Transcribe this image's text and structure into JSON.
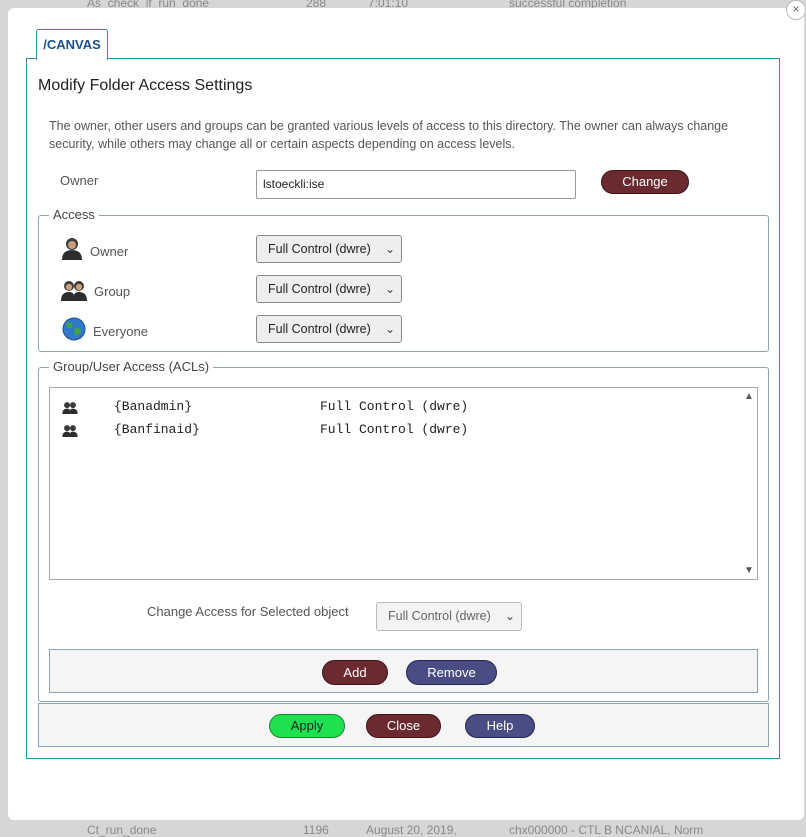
{
  "background": {
    "rows": [
      {
        "name": "As_check_if_run_done",
        "count": "288",
        "time": "7:01:10",
        "status": "successful completion"
      },
      {
        "name": "Ct_run_done",
        "count": "1196",
        "time": "August 20, 2019,",
        "status": "chx000000 - CTL B NCANIAL, Norm"
      }
    ]
  },
  "dialog": {
    "close_symbol": "×",
    "tab_label": "/CANVAS",
    "title": "Modify Folder Access Settings",
    "description": "The owner, other users and groups can be granted various levels of access to this directory. The owner can always change security, while others may change all or certain aspects depending on access levels.",
    "owner": {
      "label": "Owner",
      "value": "lstoeckli:ise",
      "change_label": "Change"
    },
    "access": {
      "legend": "Access",
      "rows": [
        {
          "label": "Owner",
          "icon": "user-icon",
          "value": "Full Control (dwre)"
        },
        {
          "label": "Group",
          "icon": "group-icon",
          "value": "Full Control (dwre)"
        },
        {
          "label": "Everyone",
          "icon": "globe-icon",
          "value": "Full Control (dwre)"
        }
      ]
    },
    "acl": {
      "legend": "Group/User Access (ACLs)",
      "entries": [
        {
          "icon": "group-icon",
          "name": "{Banadmin}",
          "permission": "Full Control (dwre)"
        },
        {
          "icon": "group-icon",
          "name": "{Banfinaid}",
          "permission": "Full Control (dwre)"
        }
      ],
      "change_label": "Change Access for Selected object",
      "change_value": "Full Control (dwre)",
      "add_label": "Add",
      "remove_label": "Remove"
    },
    "footer": {
      "apply_label": "Apply",
      "close_label": "Close",
      "help_label": "Help"
    },
    "colors": {
      "accent": "#2a93a8",
      "maroon": "#6b2a2f",
      "navy": "#4a4d84",
      "green": "#1fe14f"
    }
  }
}
